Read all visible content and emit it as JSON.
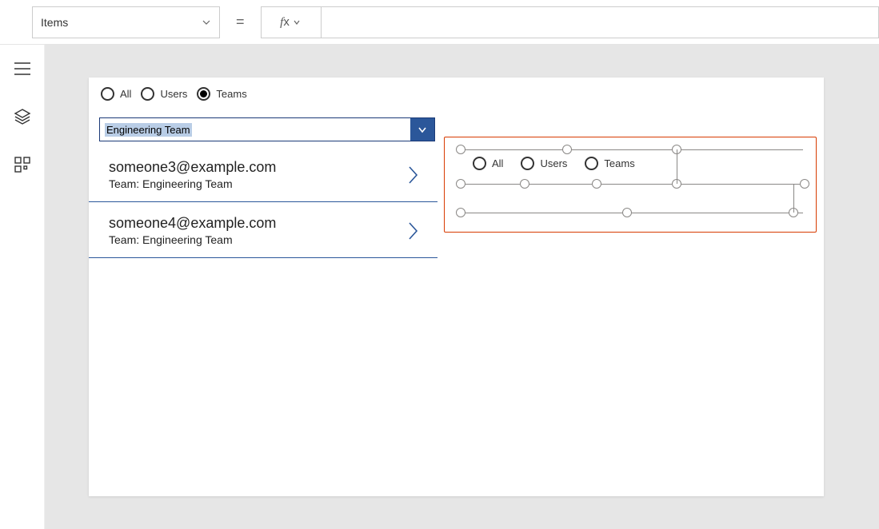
{
  "formula_bar": {
    "property": "Items",
    "equals": "=",
    "fx": "fx"
  },
  "left_panel": {
    "radios": {
      "all": "All",
      "users": "Users",
      "teams": "Teams",
      "selected": "teams"
    },
    "dropdown_value": "Engineering Team",
    "results": [
      {
        "email": "someone3@example.com",
        "team_line": "Team: Engineering Team"
      },
      {
        "email": "someone4@example.com",
        "team_line": "Team: Engineering Team"
      }
    ]
  },
  "selected_control": {
    "radios": {
      "all": "All",
      "users": "Users",
      "teams": "Teams"
    }
  }
}
